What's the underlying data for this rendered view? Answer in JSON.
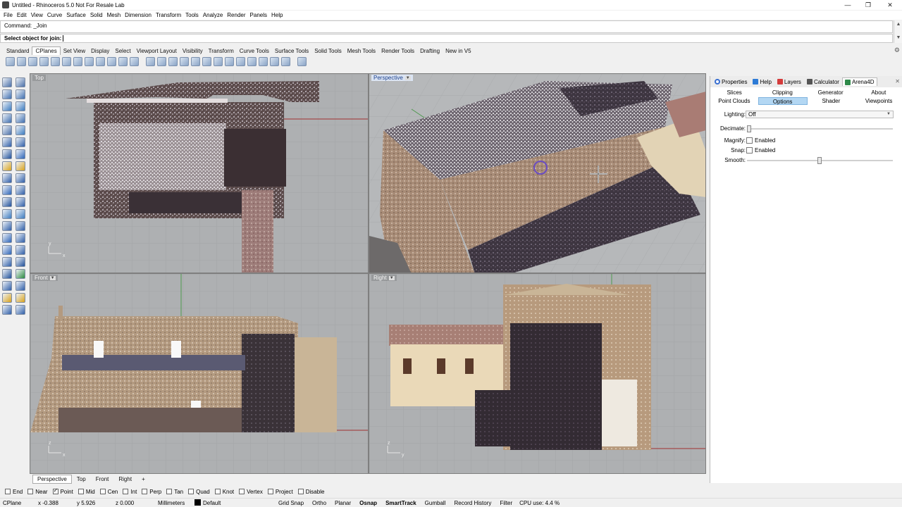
{
  "window": {
    "title": "Untitled - Rhinoceros 5.0 Not For Resale Lab",
    "controls": [
      "minimize",
      "restore",
      "close"
    ]
  },
  "menu": [
    "File",
    "Edit",
    "View",
    "Curve",
    "Surface",
    "Solid",
    "Mesh",
    "Dimension",
    "Transform",
    "Tools",
    "Analyze",
    "Render",
    "Panels",
    "Help"
  ],
  "command": {
    "history": "Command: _Join",
    "prompt": "Select object for join:"
  },
  "toolbar_tabs": [
    "Standard",
    "CPlanes",
    "Set View",
    "Display",
    "Select",
    "Viewport Layout",
    "Visibility",
    "Transform",
    "Curve Tools",
    "Surface Tools",
    "Solid Tools",
    "Mesh Tools",
    "Render Tools",
    "Drafting",
    "New in V5"
  ],
  "toolbar_active_tab": "CPlanes",
  "viewports": {
    "top": {
      "label": "Top"
    },
    "perspective": {
      "label": "Perspective"
    },
    "front": {
      "label": "Front"
    },
    "right": {
      "label": "Right"
    }
  },
  "viewport_tabs": [
    "Perspective",
    "Top",
    "Front",
    "Right",
    "+"
  ],
  "panel": {
    "tabs": [
      {
        "label": "Properties",
        "icon": "properties-icon",
        "color": "#3a6fd1"
      },
      {
        "label": "Help",
        "icon": "help-icon",
        "color": "#2d7bd6"
      },
      {
        "label": "Layers",
        "icon": "layers-icon",
        "color": "#d43b3b"
      },
      {
        "label": "Calculator",
        "icon": "calculator-icon",
        "color": "#555555"
      },
      {
        "label": "Arena4D",
        "icon": "arena4d-icon",
        "color": "#2f8a4a"
      }
    ],
    "subtabs_row1": [
      "Slices",
      "Clipping",
      "Generator",
      "About"
    ],
    "subtabs_row2": [
      "Point Clouds",
      "Options",
      "Shader",
      "Viewpoints"
    ],
    "active_subtab": "Options",
    "options": {
      "lighting_label": "Lighting:",
      "lighting_value": "Off",
      "decimate_label": "Decimate:",
      "magnify_label": "Magnify:",
      "magnify_check": "Enabled",
      "snap_label": "Snap:",
      "snap_check": "Enabled",
      "smooth_label": "Smooth:"
    }
  },
  "osnaps": [
    {
      "label": "End",
      "checked": false
    },
    {
      "label": "Near",
      "checked": false
    },
    {
      "label": "Point",
      "checked": true
    },
    {
      "label": "Mid",
      "checked": false
    },
    {
      "label": "Cen",
      "checked": false
    },
    {
      "label": "Int",
      "checked": false
    },
    {
      "label": "Perp",
      "checked": false
    },
    {
      "label": "Tan",
      "checked": false
    },
    {
      "label": "Quad",
      "checked": false
    },
    {
      "label": "Knot",
      "checked": false
    },
    {
      "label": "Vertex",
      "checked": false
    },
    {
      "label": "Project",
      "checked": false
    },
    {
      "label": "Disable",
      "checked": false
    }
  ],
  "status": {
    "cplane": "CPlane",
    "x": "x -0.388",
    "y": "y 5.926",
    "z": "z 0.000",
    "units": "Millimeters",
    "layer": "Default",
    "buttons": [
      "Grid Snap",
      "Ortho",
      "Planar",
      "Osnap",
      "SmartTrack",
      "Gumball",
      "Record History",
      "Filter"
    ],
    "cpu": "CPU use: 4.4 %"
  }
}
